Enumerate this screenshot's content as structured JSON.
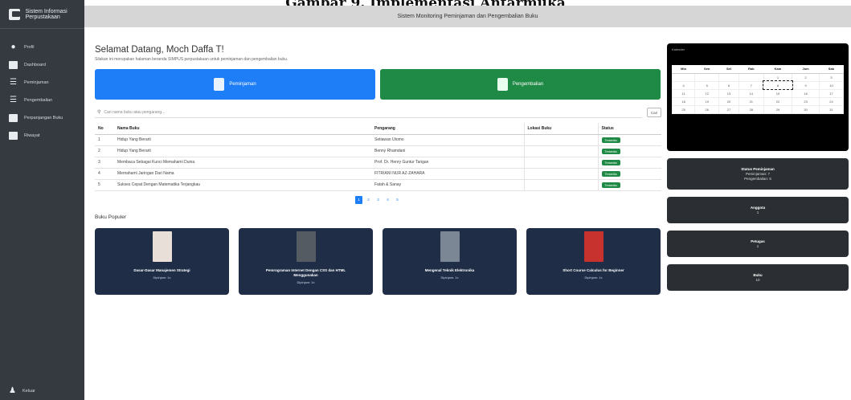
{
  "caption": "Gambar 9. Implementasi Antarmuka",
  "app": {
    "brand": "Sistem Informasi Perpustakaan",
    "topbar_title": "Sistem Monitoring Peminjaman dan Pengembalian Buku"
  },
  "sidebar": {
    "items": [
      {
        "label": "Profil",
        "icon": "user-circle-icon"
      },
      {
        "label": "Dashboard",
        "icon": "grid-icon"
      },
      {
        "label": "Peminjaman",
        "icon": "book-open-icon"
      },
      {
        "label": "Pengembalian",
        "icon": "list-icon"
      },
      {
        "label": "Perpanjangan Buku",
        "icon": "list-icon"
      },
      {
        "label": "Riwayat",
        "icon": "list-icon"
      }
    ],
    "logout": "Keluar"
  },
  "main": {
    "welcome": "Selamat Datang, Moch Daffa T!",
    "subtitle": "Silakan ini merupakan halaman beranda SIMPUS perpustakaan untuk peminjaman dan pengembalian buku.",
    "btn_pinjam": "Peminjaman",
    "btn_kembali": "Pengembalian",
    "search_placeholder": "Cari nama buku atau pengarang...",
    "search_button": "Cari",
    "table": {
      "headers": [
        "No",
        "Nama Buku",
        "Pengarang",
        "Lokasi Buku",
        "Status"
      ],
      "rows": [
        [
          "1",
          "Hidup Yang Berarti",
          "Setiawan Utomo",
          "",
          "Tersedia"
        ],
        [
          "2",
          "Hidup Yang Berarti",
          "Benny Rhamdani",
          "",
          "Tersedia"
        ],
        [
          "3",
          "Membaca Sebagai Kunci Memahami Dunia",
          "Prof. Dr. Henry Guntur Tarigan",
          "",
          "Tersedia"
        ],
        [
          "4",
          "Memahami Jaringan Dari Nama",
          "FITRIANI NUR AZ-ZAHARA",
          "",
          "Tersedia"
        ],
        [
          "5",
          "Sukses Cepat Dengan Matematika Terjangkau",
          "Fatah & Sanay",
          "",
          "Tersedia"
        ]
      ]
    },
    "pagination": [
      "1",
      "2",
      "3",
      "4",
      "5"
    ],
    "popular_title": "Buku Populer",
    "books": [
      {
        "title": "Dasar-Dasar Manajemen Strategi",
        "count": "Dipinjam: 1x",
        "cover": "#e8e0d8"
      },
      {
        "title": "Pemrograman Internet Dengan CSS dan HTML Menggunakan",
        "count": "Dipinjam: 1x",
        "cover": "#555b62"
      },
      {
        "title": "Mengenal Teknik Elektronika",
        "count": "Dipinjam: 1x",
        "cover": "#7b8794"
      },
      {
        "title": "Short Course Calculus for Beginner",
        "count": "Dipinjam: 1x",
        "cover": "#c8322e"
      }
    ]
  },
  "calendar": {
    "title": "Kalender",
    "sub": "",
    "days": [
      "Min",
      "Sen",
      "Sel",
      "Rab",
      "Kam",
      "Jum",
      "Sab"
    ],
    "weeks": [
      [
        "",
        "",
        "",
        "",
        "1",
        "2",
        "3"
      ],
      [
        "4",
        "5",
        "6",
        "7",
        "8",
        "9",
        "10"
      ],
      [
        "11",
        "12",
        "13",
        "14",
        "15",
        "16",
        "17"
      ],
      [
        "18",
        "19",
        "20",
        "21",
        "22",
        "23",
        "24"
      ],
      [
        "25",
        "26",
        "27",
        "28",
        "29",
        "30",
        "31"
      ]
    ],
    "today": "8"
  },
  "stats": [
    {
      "title": "Status Peminjaman",
      "lines": [
        "Peminjaman: 7",
        "Pengembalian: 5"
      ]
    },
    {
      "title": "Anggota",
      "lines": [
        "1"
      ]
    },
    {
      "title": "Petugas",
      "lines": [
        "1"
      ]
    },
    {
      "title": "Buku",
      "lines": [
        "10"
      ]
    }
  ]
}
